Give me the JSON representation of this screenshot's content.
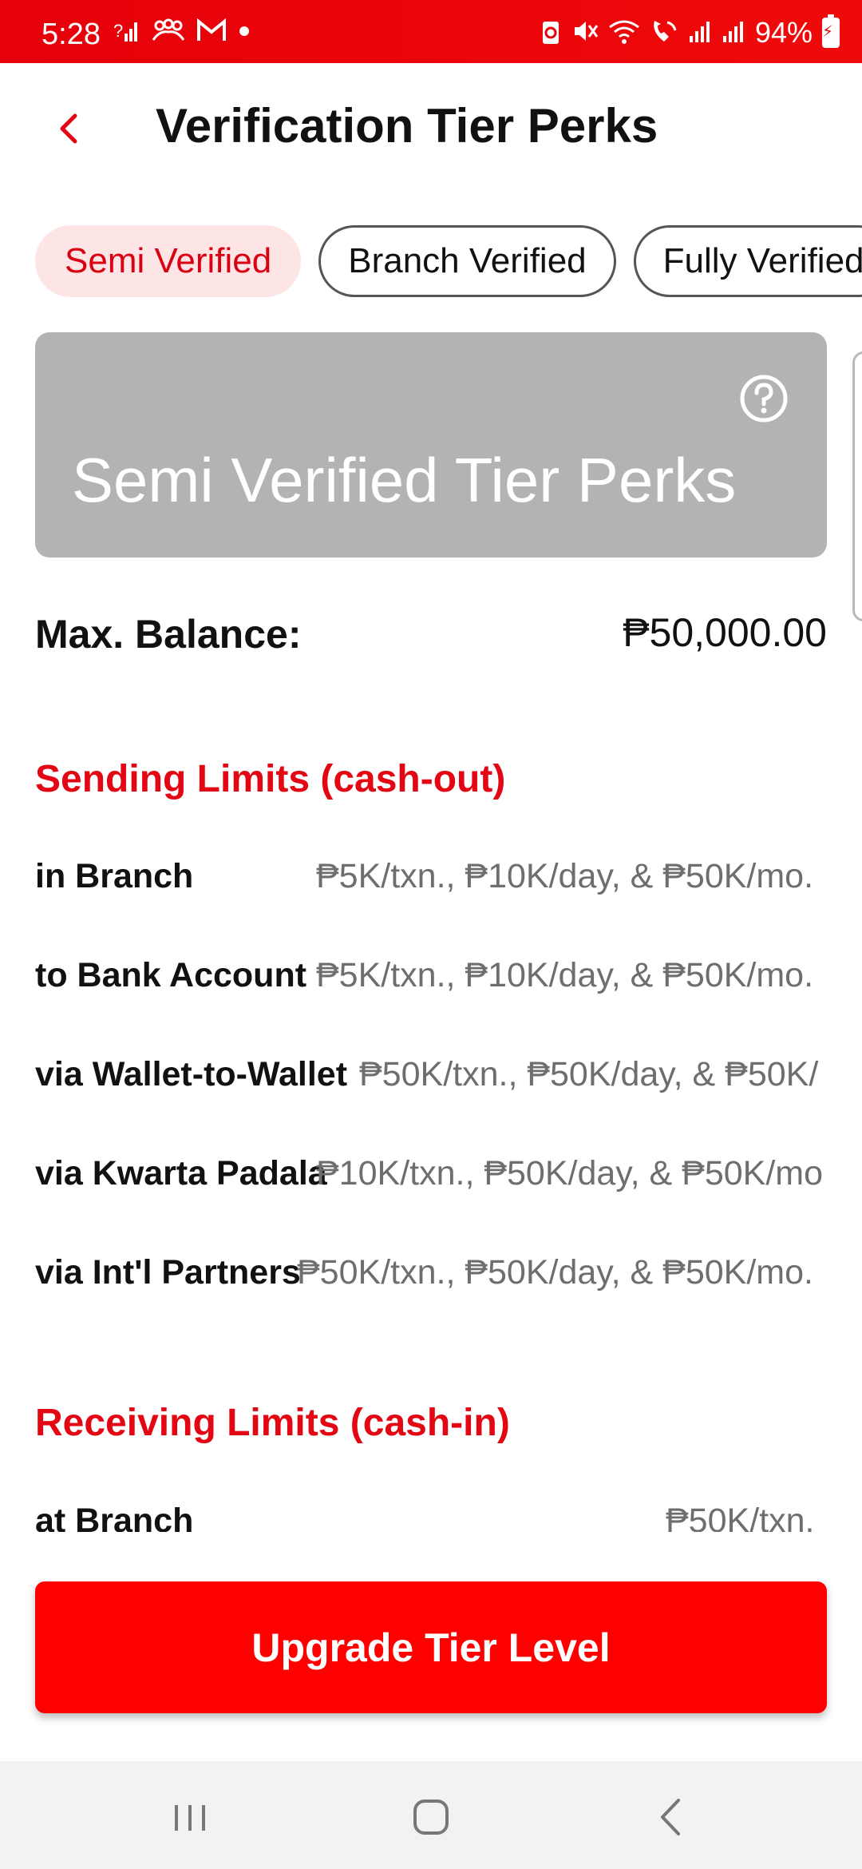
{
  "status_bar": {
    "time": "5:28",
    "battery": "94%",
    "icons": [
      "signal-unknown-icon",
      "group-icon",
      "gmail-icon",
      "dot-icon",
      "battery-saver-icon",
      "mute-icon",
      "wifi-icon",
      "wifi-call-icon",
      "signal-icon",
      "signal-icon"
    ]
  },
  "header": {
    "title": "Verification Tier Perks"
  },
  "tabs": [
    {
      "label": "Semi Verified",
      "active": true
    },
    {
      "label": "Branch Verified",
      "active": false
    },
    {
      "label": "Fully Verified",
      "active": false
    }
  ],
  "card": {
    "title": "Semi Verified Tier Perks"
  },
  "balance": {
    "label": "Max. Balance:",
    "value": "₱50,000.00"
  },
  "sending": {
    "title": "Sending Limits (cash-out)",
    "rows": [
      {
        "label": "in Branch",
        "value": "₱5K/txn., ₱10K/day, & ₱50K/mo."
      },
      {
        "label": "to Bank Account",
        "value": "₱5K/txn., ₱10K/day, & ₱50K/mo."
      },
      {
        "label": "via Wallet-to-Wallet",
        "value": "₱50K/txn., ₱50K/day, & ₱50K/"
      },
      {
        "label": "via Kwarta Padala",
        "value": "₱10K/txn., ₱50K/day, & ₱50K/mo"
      },
      {
        "label": "via Int'l Partners",
        "value": "₱50K/txn., ₱50K/day, & ₱50K/mo."
      }
    ]
  },
  "receiving": {
    "title": "Receiving Limits (cash-in)",
    "rows": [
      {
        "label": "at Branch",
        "value": "₱50K/txn."
      }
    ]
  },
  "actions": {
    "upgrade_label": "Upgrade Tier Level"
  },
  "colors": {
    "accent": "#e30613",
    "card_bg": "#b3b3b3",
    "active_tab_bg": "#fde5e6"
  }
}
